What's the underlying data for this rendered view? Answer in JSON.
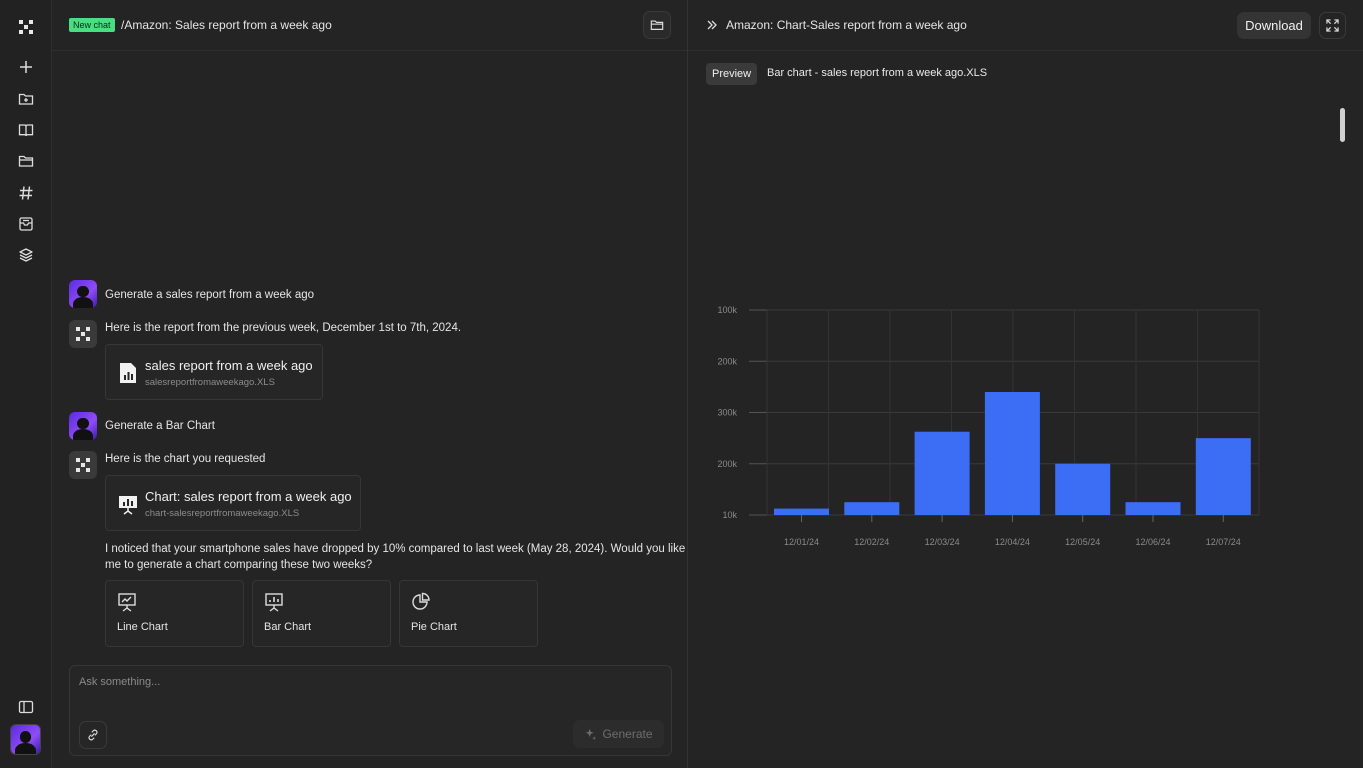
{
  "sidebar": {
    "icons": [
      "apps-grid-icon",
      "plus-icon",
      "folder-add-icon",
      "book-icon",
      "folder-icon",
      "hashtag-icon",
      "inbox-icon",
      "layers-icon"
    ],
    "bottom_icons": [
      "sidebar-toggle-icon"
    ]
  },
  "chat": {
    "badge": "New chat",
    "title": "/Amazon: Sales report from a week ago",
    "messages": [
      {
        "role": "user",
        "text": "Generate a sales report from a week ago"
      },
      {
        "role": "assistant",
        "text": "Here is the report from the previous week, December 1st to 7th, 2024."
      },
      {
        "role": "user",
        "text": "Generate a Bar Chart"
      },
      {
        "role": "assistant",
        "text": "Here is the chart you requested"
      }
    ],
    "file1": {
      "name": "sales report from a week ago",
      "file": "salesreportfromaweekago.XLS"
    },
    "file2": {
      "name": "Chart: sales report from a week ago",
      "file": "chart-salesreportfromaweekago.XLS"
    },
    "followup_line1": "I noticed that your smartphone sales have dropped by 10% compared to last week (May 28, 2024). Would you like",
    "followup_line2": "me to generate a chart comparing these two weeks?",
    "options": [
      "Line Chart",
      "Bar Chart",
      "Pie Chart"
    ],
    "composer_placeholder": "Ask something...",
    "generate_label": "Generate"
  },
  "preview": {
    "title": "Amazon: Chart-Sales report from a week ago",
    "download_label": "Download",
    "pill": "Preview",
    "file_name": "Bar chart - sales report from a week ago.XLS"
  },
  "colors": {
    "bar": "#3b6ef5",
    "new_badge": "#4ade80"
  },
  "chart_data": {
    "type": "bar",
    "categories": [
      "12/01/24",
      "12/02/24",
      "12/03/24",
      "12/04/24",
      "12/05/24",
      "12/06/24",
      "12/07/24"
    ],
    "values": [
      2.5,
      5,
      32.5,
      48,
      20,
      5,
      30
    ],
    "y_tick_labels": [
      "100k",
      "200k",
      "300k",
      "200k",
      "10k"
    ],
    "y_tick_values": [
      80,
      60,
      40,
      20,
      0
    ],
    "ylim": [
      0,
      80
    ],
    "grid": true
  }
}
